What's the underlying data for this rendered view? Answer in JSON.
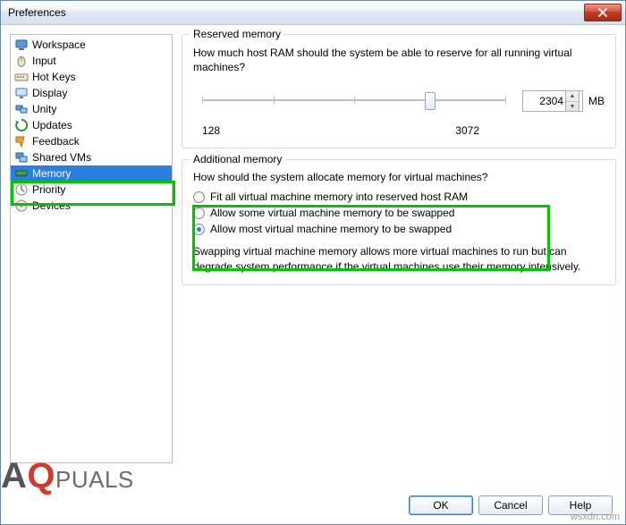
{
  "window": {
    "title": "Preferences"
  },
  "sidebar": {
    "items": [
      {
        "label": "Workspace",
        "icon": "workspace-icon"
      },
      {
        "label": "Input",
        "icon": "mouse-icon"
      },
      {
        "label": "Hot Keys",
        "icon": "keyboard-icon"
      },
      {
        "label": "Display",
        "icon": "display-icon"
      },
      {
        "label": "Unity",
        "icon": "unity-icon"
      },
      {
        "label": "Updates",
        "icon": "updates-icon"
      },
      {
        "label": "Feedback",
        "icon": "feedback-icon"
      },
      {
        "label": "Shared VMs",
        "icon": "shared-vms-icon"
      },
      {
        "label": "Memory",
        "icon": "memory-icon",
        "selected": true
      },
      {
        "label": "Priority",
        "icon": "priority-icon"
      },
      {
        "label": "Devices",
        "icon": "devices-icon"
      }
    ]
  },
  "reserved": {
    "legend": "Reserved memory",
    "question": "How much host RAM should the system be able to reserve for all running virtual machines?",
    "value": "2304",
    "unit": "MB",
    "min_label": "128",
    "max_label": "3072"
  },
  "additional": {
    "legend": "Additional memory",
    "question": "How should the system allocate memory for virtual machines?",
    "options": [
      {
        "label": "Fit all virtual machine memory into reserved host RAM",
        "checked": false
      },
      {
        "label": "Allow some virtual machine memory to be swapped",
        "checked": false
      },
      {
        "label": "Allow most virtual machine memory to be swapped",
        "checked": true
      }
    ],
    "hint": "Swapping virtual machine memory allows more virtual machines to run but can degrade system performance if the virtual machines use their memory intensively."
  },
  "buttons": {
    "ok": "OK",
    "cancel": "Cancel",
    "help": "Help"
  },
  "watermark": {
    "prefix": "A",
    "mid_red": "Q",
    "rest": "PUALS"
  },
  "source_text": "wsxdn.com"
}
